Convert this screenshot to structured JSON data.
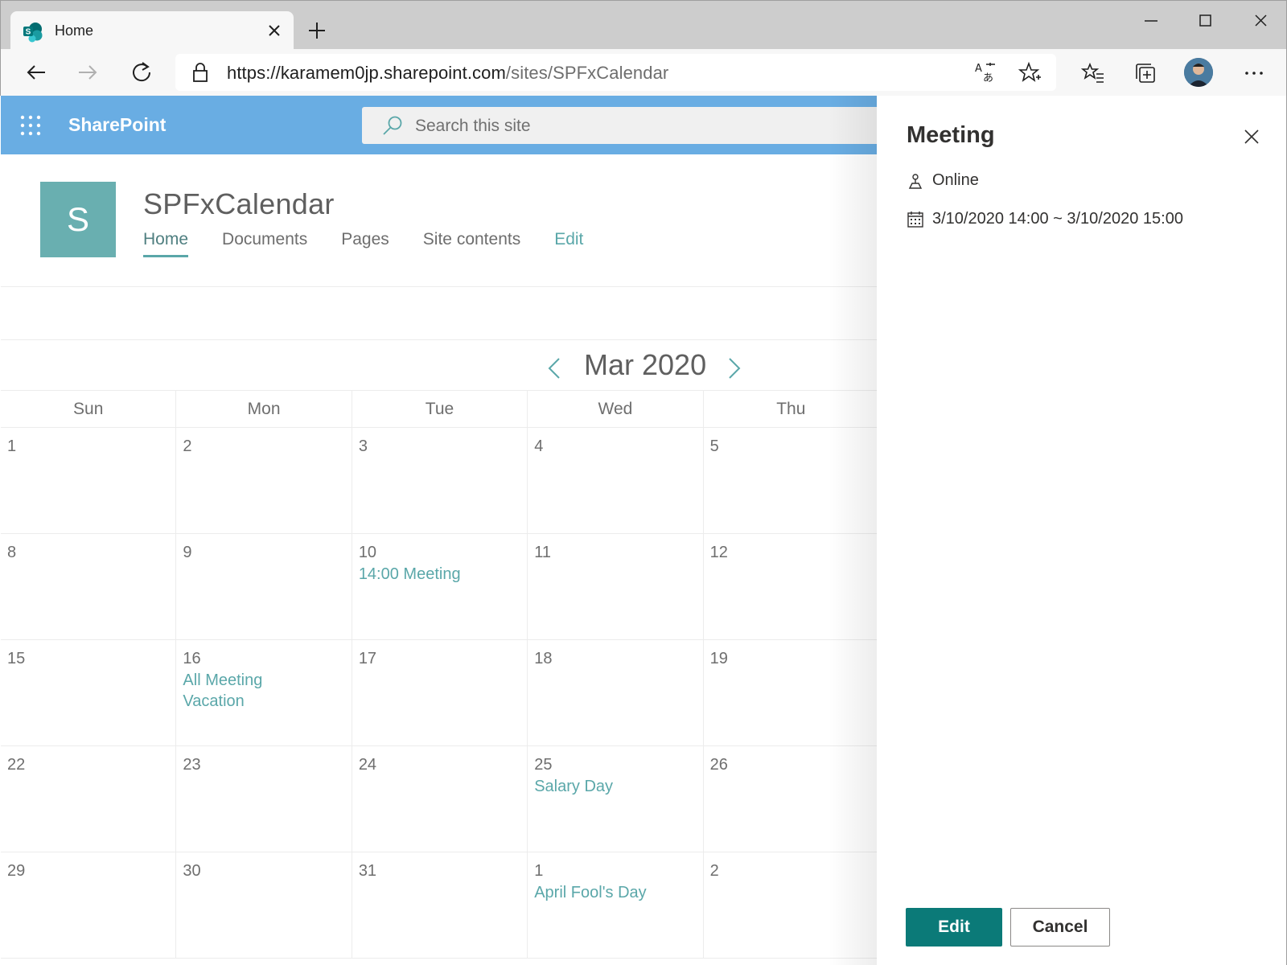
{
  "browser": {
    "tab_title": "Home",
    "url_host": "https://karamem0jp.sharepoint.com",
    "url_path": "/sites/SPFxCalendar"
  },
  "suite": {
    "brand": "SharePoint",
    "search_placeholder": "Search this site"
  },
  "site": {
    "logo_letter": "S",
    "title": "SPFxCalendar",
    "nav": [
      "Home",
      "Documents",
      "Pages",
      "Site contents",
      "Edit"
    ]
  },
  "calendar": {
    "month_label": "Mar 2020",
    "weekdays": [
      "Sun",
      "Mon",
      "Tue",
      "Wed",
      "Thu"
    ],
    "weeks": [
      [
        {
          "day": "1",
          "events": []
        },
        {
          "day": "2",
          "events": []
        },
        {
          "day": "3",
          "events": []
        },
        {
          "day": "4",
          "events": []
        },
        {
          "day": "5",
          "events": []
        }
      ],
      [
        {
          "day": "8",
          "events": []
        },
        {
          "day": "9",
          "events": []
        },
        {
          "day": "10",
          "events": [
            "14:00 Meeting"
          ]
        },
        {
          "day": "11",
          "events": []
        },
        {
          "day": "12",
          "events": []
        }
      ],
      [
        {
          "day": "15",
          "events": []
        },
        {
          "day": "16",
          "events": [
            "All Meeting",
            "Vacation"
          ]
        },
        {
          "day": "17",
          "events": []
        },
        {
          "day": "18",
          "events": []
        },
        {
          "day": "19",
          "events": []
        }
      ],
      [
        {
          "day": "22",
          "events": []
        },
        {
          "day": "23",
          "events": []
        },
        {
          "day": "24",
          "events": []
        },
        {
          "day": "25",
          "events": [
            "Salary Day"
          ]
        },
        {
          "day": "26",
          "events": []
        }
      ],
      [
        {
          "day": "29",
          "events": []
        },
        {
          "day": "30",
          "events": []
        },
        {
          "day": "31",
          "events": []
        },
        {
          "day": "1",
          "events": [
            "April Fool's Day"
          ]
        },
        {
          "day": "2",
          "events": []
        }
      ]
    ]
  },
  "panel": {
    "title": "Meeting",
    "location": "Online",
    "datetime": "3/10/2020 14:00 ~ 3/10/2020 15:00",
    "edit_label": "Edit",
    "cancel_label": "Cancel"
  },
  "colors": {
    "suite_bar": "#69ade3",
    "accent": "#5aa7a9",
    "primary_button": "#0b7a78",
    "site_logo": "#69afb0"
  }
}
